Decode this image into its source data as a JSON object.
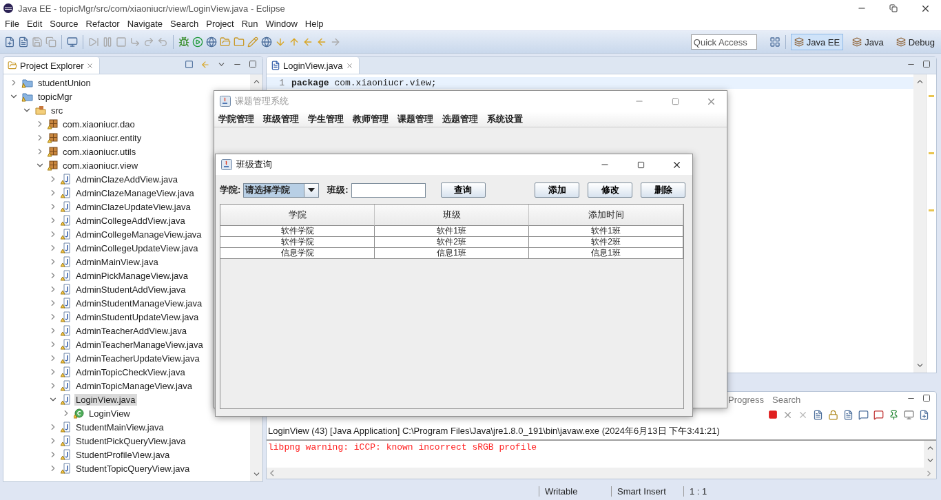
{
  "window": {
    "title": "Java EE - topicMgr/src/com/xiaoniucr/view/LoginView.java - Eclipse"
  },
  "menu": [
    "File",
    "Edit",
    "Source",
    "Refactor",
    "Navigate",
    "Search",
    "Project",
    "Run",
    "Window",
    "Help"
  ],
  "quick_access": {
    "placeholder": "Quick Access"
  },
  "perspectives": [
    {
      "label": "Java EE",
      "selected": true
    },
    {
      "label": "Java",
      "selected": false
    },
    {
      "label": "Debug",
      "selected": false
    }
  ],
  "project_explorer": {
    "title": "Project Explorer",
    "tree": [
      {
        "label": "studentUnion",
        "kind": "project",
        "expanded": false,
        "selected": false
      },
      {
        "label": "topicMgr",
        "kind": "project",
        "expanded": true,
        "selected": false,
        "children": [
          {
            "label": "src",
            "kind": "folder",
            "expanded": true,
            "selected": false,
            "children": [
              {
                "label": "com.xiaoniucr.dao",
                "kind": "package",
                "expanded": false,
                "selected": false
              },
              {
                "label": "com.xiaoniucr.entity",
                "kind": "package",
                "expanded": false,
                "selected": false
              },
              {
                "label": "com.xiaoniucr.utils",
                "kind": "package",
                "expanded": false,
                "selected": false
              },
              {
                "label": "com.xiaoniucr.view",
                "kind": "package",
                "expanded": true,
                "selected": false,
                "children": [
                  {
                    "label": "AdminClazeAddView.java",
                    "kind": "file",
                    "expanded": false,
                    "selected": false
                  },
                  {
                    "label": "AdminClazeManageView.java",
                    "kind": "file",
                    "expanded": false,
                    "selected": false
                  },
                  {
                    "label": "AdminClazeUpdateView.java",
                    "kind": "file",
                    "expanded": false,
                    "selected": false
                  },
                  {
                    "label": "AdminCollegeAddView.java",
                    "kind": "file",
                    "expanded": false,
                    "selected": false
                  },
                  {
                    "label": "AdminCollegeManageView.java",
                    "kind": "file",
                    "expanded": false,
                    "selected": false
                  },
                  {
                    "label": "AdminCollegeUpdateView.java",
                    "kind": "file",
                    "expanded": false,
                    "selected": false
                  },
                  {
                    "label": "AdminMainView.java",
                    "kind": "file",
                    "expanded": false,
                    "selected": false
                  },
                  {
                    "label": "AdminPickManageView.java",
                    "kind": "file",
                    "expanded": false,
                    "selected": false
                  },
                  {
                    "label": "AdminStudentAddView.java",
                    "kind": "file",
                    "expanded": false,
                    "selected": false
                  },
                  {
                    "label": "AdminStudentManageView.java",
                    "kind": "file",
                    "expanded": false,
                    "selected": false
                  },
                  {
                    "label": "AdminStudentUpdateView.java",
                    "kind": "file",
                    "expanded": false,
                    "selected": false
                  },
                  {
                    "label": "AdminTeacherAddView.java",
                    "kind": "file",
                    "expanded": false,
                    "selected": false
                  },
                  {
                    "label": "AdminTeacherManageView.java",
                    "kind": "file",
                    "expanded": false,
                    "selected": false
                  },
                  {
                    "label": "AdminTeacherUpdateView.java",
                    "kind": "file",
                    "expanded": false,
                    "selected": false
                  },
                  {
                    "label": "AdminTopicCheckView.java",
                    "kind": "file",
                    "expanded": false,
                    "selected": false
                  },
                  {
                    "label": "AdminTopicManageView.java",
                    "kind": "file",
                    "expanded": false,
                    "selected": false
                  },
                  {
                    "label": "LoginView.java",
                    "kind": "file",
                    "expanded": true,
                    "selected": true,
                    "children": [
                      {
                        "label": "LoginView",
                        "kind": "class",
                        "expanded": false,
                        "selected": false
                      }
                    ]
                  },
                  {
                    "label": "StudentMainView.java",
                    "kind": "file",
                    "expanded": false,
                    "selected": false
                  },
                  {
                    "label": "StudentPickQueryView.java",
                    "kind": "file",
                    "expanded": false,
                    "selected": false
                  },
                  {
                    "label": "StudentProfileView.java",
                    "kind": "file",
                    "expanded": false,
                    "selected": false
                  },
                  {
                    "label": "StudentTopicQueryView.java",
                    "kind": "file",
                    "expanded": false,
                    "selected": false
                  }
                ]
              }
            ]
          }
        ]
      }
    ]
  },
  "editor": {
    "tab": "LoginView.java",
    "lines": [
      {
        "number": "1",
        "text": "**package** com.xiaoniucr.view;"
      }
    ]
  },
  "bottom_panel": {
    "tabs": [
      "Progress",
      "Search"
    ],
    "console_title": "LoginView (43) [Java Application] C:\\Program Files\\Java\\jre1.8.0_191\\bin\\javaw.exe (2024年6月13日 下午3:41:21)",
    "output": [
      {
        "text": "libpng warning: iCCP: known incorrect sRGB profile",
        "kind": "error"
      }
    ]
  },
  "status_bar": [
    "Writable",
    "Smart Insert",
    "1 : 1"
  ],
  "app_frame": {
    "title": "课题管理系统",
    "menu": [
      "学院管理",
      "班级管理",
      "学生管理",
      "教师管理",
      "课题管理",
      "选题管理",
      "系统设置"
    ]
  },
  "dialog": {
    "title": "班级查询",
    "college_label": "学院:",
    "college_select": "请选择学院",
    "class_label": "班级:",
    "search_button": "查询",
    "actions": [
      "添加",
      "修改",
      "删除"
    ],
    "table": {
      "columns": [
        "学院",
        "班级",
        "添加时间"
      ],
      "rows": [
        [
          "软件学院",
          "软件1班",
          "软件1班"
        ],
        [
          "软件学院",
          "软件2班",
          "软件2班"
        ],
        [
          "信息学院",
          "信息1班",
          "信息1班"
        ]
      ]
    }
  }
}
